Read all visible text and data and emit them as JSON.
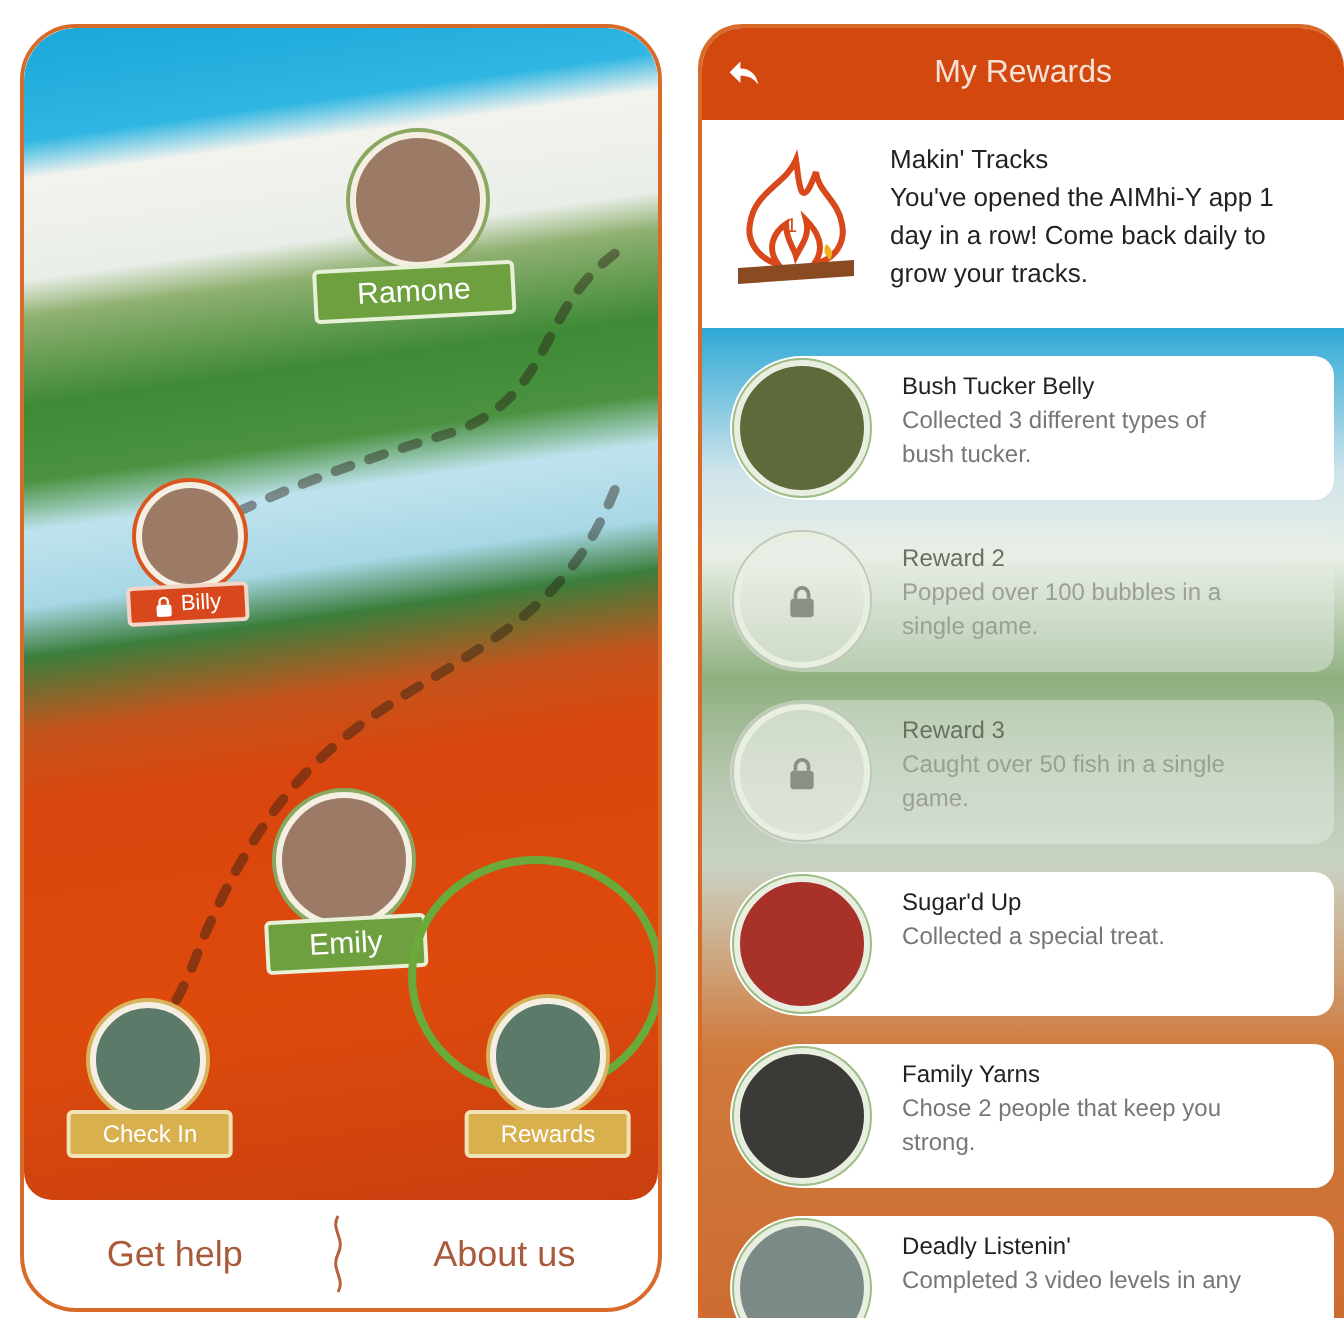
{
  "map_screen": {
    "nodes": [
      {
        "kind": "person",
        "label": "Ramone",
        "locked": false,
        "highlighted": false
      },
      {
        "kind": "person",
        "label": "Billy",
        "locked": true,
        "highlighted": false
      },
      {
        "kind": "person",
        "label": "Emily",
        "locked": false,
        "highlighted": false
      },
      {
        "kind": "action",
        "label": "Check In",
        "locked": false,
        "highlighted": false
      },
      {
        "kind": "action",
        "label": "Rewards",
        "locked": false,
        "highlighted": true
      }
    ],
    "footer": {
      "links": [
        "Get help",
        "About us"
      ]
    }
  },
  "rewards_screen": {
    "title": "My Rewards",
    "featured": {
      "title": "Makin' Tracks",
      "description": "You've opened the AIMhi-Y app 1 day in a row! Come back daily to grow your tracks.",
      "badge_number": "1"
    },
    "items": [
      {
        "title": "Bush Tucker Belly",
        "description": "Collected 3 different types of bush tucker.",
        "locked": false
      },
      {
        "title": "Reward 2",
        "description": "Popped over 100 bubbles in a single game.",
        "locked": true
      },
      {
        "title": "Reward 3",
        "description": "Caught over 50 fish in a single game.",
        "locked": true
      },
      {
        "title": "Sugar'd Up",
        "description": "Collected a special treat.",
        "locked": false
      },
      {
        "title": "Family Yarns",
        "description": "Chose 2 people that keep you strong.",
        "locked": false
      },
      {
        "title": "Deadly Listenin'",
        "description": "Completed 3 video levels in any",
        "locked": false
      }
    ]
  }
}
